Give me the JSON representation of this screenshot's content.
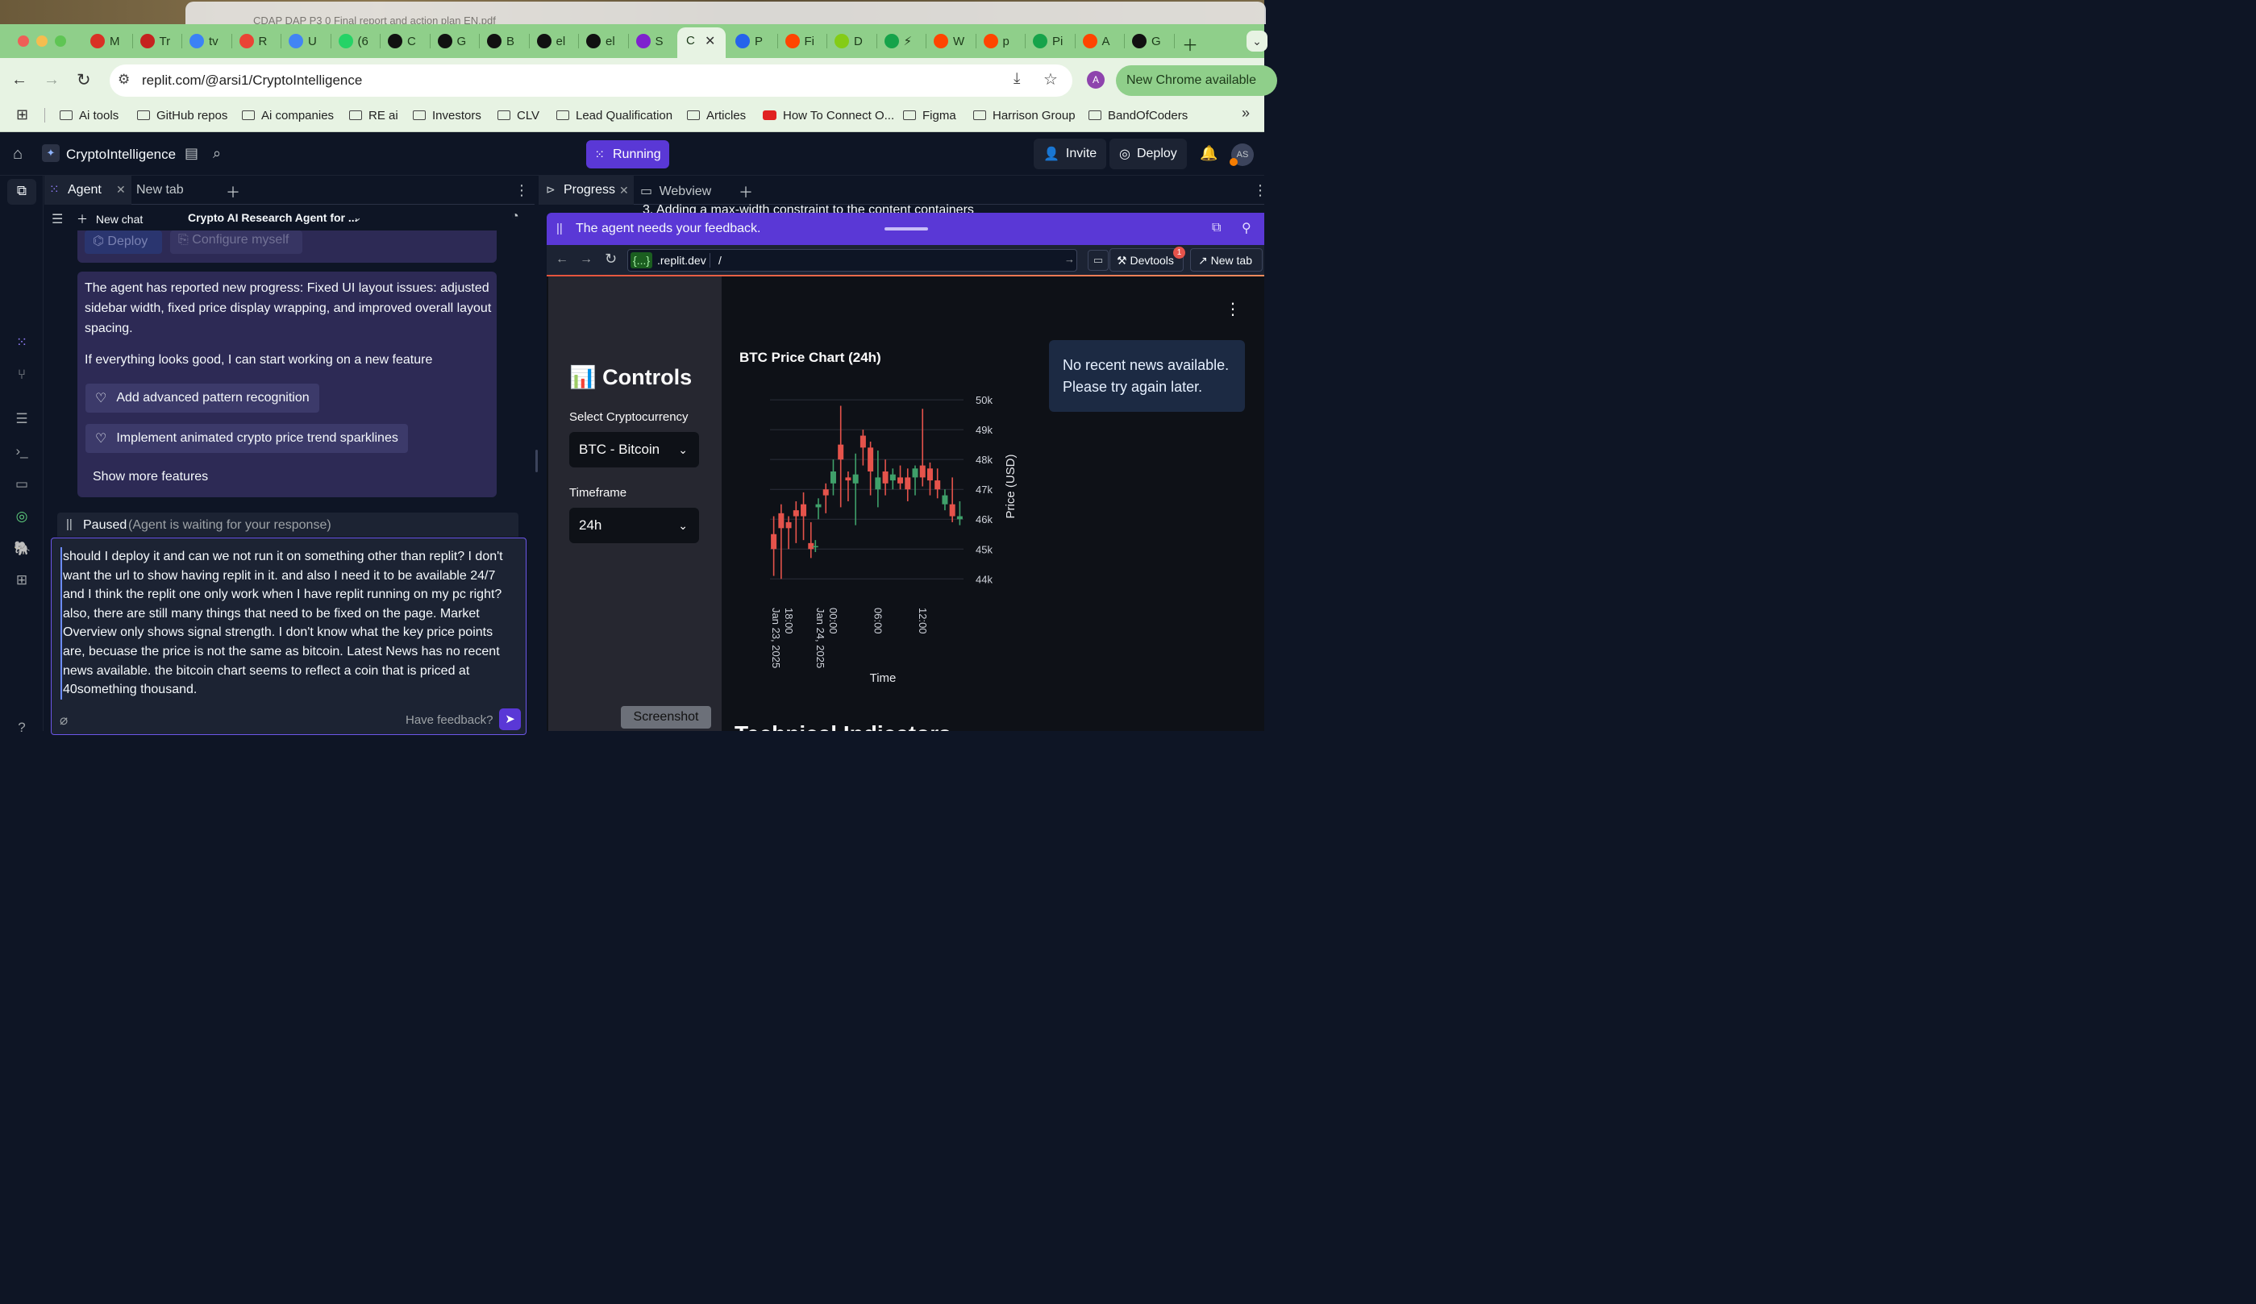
{
  "browser": {
    "bg_title": "CDAP DAP P3 0 Final report and action plan EN.pdf",
    "tabs": [
      {
        "label": "M",
        "color": "#d93025"
      },
      {
        "label": "Tr",
        "color": "#c5221f"
      },
      {
        "label": "tv",
        "color": "#3b82f6"
      },
      {
        "label": "R",
        "color": "#ea4335"
      },
      {
        "label": "U",
        "color": "#4285f4"
      },
      {
        "label": "(6",
        "color": "#25d366"
      },
      {
        "label": "C",
        "color": "#111111"
      },
      {
        "label": "G",
        "color": "#111111"
      },
      {
        "label": "B",
        "color": "#111111"
      },
      {
        "label": "el",
        "color": "#111111"
      },
      {
        "label": "el",
        "color": "#111111"
      },
      {
        "label": "S",
        "color": "#7e22ce"
      }
    ],
    "active_tab_label": "C",
    "right_tabs": [
      {
        "label": "P",
        "color": "#2563eb"
      },
      {
        "label": "Fi",
        "color": "#ff4500"
      },
      {
        "label": "D",
        "color": "#84cc16"
      },
      {
        "label": "⚡",
        "color": "#16a34a"
      },
      {
        "label": "W",
        "color": "#ff4500"
      },
      {
        "label": "p",
        "color": "#ff4500"
      },
      {
        "label": "Pi",
        "color": "#16a34a"
      },
      {
        "label": "A",
        "color": "#ff4500"
      },
      {
        "label": "G",
        "color": "#111111"
      }
    ],
    "url": "replit.com/@arsi1/CryptoIntelligence",
    "profile_initial": "A",
    "update_label": "New Chrome available",
    "bookmarks": [
      "Ai tools",
      "GitHub repos",
      "Ai companies",
      "RE ai",
      "Investors",
      "CLV",
      "Lead Qualification",
      "Articles",
      "How To Connect O...",
      "Figma",
      "Harrison Group",
      "BandOfCoders"
    ]
  },
  "replit": {
    "project_name": "CryptoIntelligence",
    "run_label": "Running",
    "invite_label": "Invite",
    "deploy_label": "Deploy",
    "avatar_initials": "AS",
    "left_tabs": {
      "agent": "Agent",
      "new_tab": "New tab"
    },
    "chat_bar": {
      "new_chat": "New chat",
      "title": "Crypto AI Research Agent for ..."
    },
    "top_card": {
      "deploy": "Deploy",
      "configure": "Configure myself"
    },
    "progress_message": "The agent has reported new progress: Fixed UI layout issues: adjusted sidebar width, fixed price display wrapping, and improved overall layout spacing.",
    "followup": "If everything looks good, I can start working on a new feature",
    "suggestions": [
      "Add advanced pattern recognition",
      "Implement animated crypto price trend sparklines"
    ],
    "show_more": "Show more features",
    "paused_label": "Paused",
    "paused_sub": "(Agent is waiting for your response)",
    "input_text": "should I deploy it and can we not run it on something other than replit? I don't want the url to show having replit in it. and also I need it to be available 24/7 and I think the replit one only work when I have replit running on my pc right? also, there are still many things that need to be fixed on the page. Market Overview only shows signal strength. I don't know what the key price points are, becuase the price is not the same as bitcoin. Latest News has no recent news available. the bitcoin chart seems to reflect a coin that is priced at 40something thousand.",
    "have_feedback": "Have feedback?",
    "right_tabs": {
      "progress": "Progress",
      "webview": "Webview"
    },
    "behind_text": "3. Adding a max-width constraint to the content containers",
    "feedback_bar": "The agent needs your feedback.",
    "webview": {
      "domain_prefix": "{...}",
      "domain": ".replit.dev",
      "path": "/",
      "devtools": "Devtools",
      "devtools_badge": "1",
      "new_tab": "New tab"
    },
    "screenshot_label": "Screenshot"
  },
  "app": {
    "controls_title": "Controls",
    "controls_emoji": "📊",
    "select_crypto_label": "Select Cryptocurrency",
    "select_crypto_value": "BTC - Bitcoin",
    "timeframe_label": "Timeframe",
    "timeframe_value": "24h",
    "news_message": "No recent news available. Please try again later.",
    "cutoff_heading": "Technical Indicators"
  },
  "chart_data": {
    "type": "candlestick",
    "title": "BTC Price Chart (24h)",
    "xlabel": "Time",
    "ylabel": "Price (USD)",
    "ylim": [
      43900,
      50300
    ],
    "yticks": [
      {
        "v": 44000,
        "label": "44k"
      },
      {
        "v": 45000,
        "label": "45k"
      },
      {
        "v": 46000,
        "label": "46k"
      },
      {
        "v": 47000,
        "label": "47k"
      },
      {
        "v": 48000,
        "label": "48k"
      },
      {
        "v": 49000,
        "label": "49k"
      },
      {
        "v": 50000,
        "label": "50k"
      }
    ],
    "xticks": [
      {
        "h": 18,
        "label": "18:00",
        "sub": "Jan 23, 2025"
      },
      {
        "h": 24,
        "label": "00:00",
        "sub": "Jan 24, 2025"
      },
      {
        "h": 30,
        "label": "06:00",
        "sub": ""
      },
      {
        "h": 36,
        "label": "12:00",
        "sub": ""
      }
    ],
    "xlim": [
      16.5,
      42.5
    ],
    "up_color": "#3fa06a",
    "down_color": "#e5534b",
    "candles": [
      {
        "h": 17.0,
        "o": 45500,
        "c": 45000,
        "hi": 46100,
        "lo": 44100
      },
      {
        "h": 18.0,
        "o": 46200,
        "c": 45700,
        "hi": 46500,
        "lo": 44000
      },
      {
        "h": 19.0,
        "o": 45900,
        "c": 45700,
        "hi": 46100,
        "lo": 45000
      },
      {
        "h": 20.0,
        "o": 46300,
        "c": 46100,
        "hi": 46600,
        "lo": 45200
      },
      {
        "h": 21.0,
        "o": 46500,
        "c": 46100,
        "hi": 46900,
        "lo": 45300
      },
      {
        "h": 22.0,
        "o": 45200,
        "c": 45000,
        "hi": 45900,
        "lo": 44700
      },
      {
        "h": 22.6,
        "o": 45100,
        "c": 45100,
        "hi": 45300,
        "lo": 44900
      },
      {
        "h": 23.0,
        "o": 46400,
        "c": 46500,
        "hi": 46700,
        "lo": 46000
      },
      {
        "h": 24.0,
        "o": 47000,
        "c": 46800,
        "hi": 47200,
        "lo": 46200
      },
      {
        "h": 25.0,
        "o": 47200,
        "c": 47600,
        "hi": 48000,
        "lo": 46800
      },
      {
        "h": 26.0,
        "o": 48500,
        "c": 48000,
        "hi": 49800,
        "lo": 46400
      },
      {
        "h": 27.0,
        "o": 47400,
        "c": 47300,
        "hi": 47600,
        "lo": 46600
      },
      {
        "h": 28.0,
        "o": 47200,
        "c": 47500,
        "hi": 48200,
        "lo": 45800
      },
      {
        "h": 29.0,
        "o": 48800,
        "c": 48400,
        "hi": 49000,
        "lo": 47800
      },
      {
        "h": 30.0,
        "o": 48400,
        "c": 47600,
        "hi": 48600,
        "lo": 46800
      },
      {
        "h": 31.0,
        "o": 47000,
        "c": 47400,
        "hi": 48300,
        "lo": 46400
      },
      {
        "h": 32.0,
        "o": 47600,
        "c": 47200,
        "hi": 48000,
        "lo": 46800
      },
      {
        "h": 33.0,
        "o": 47300,
        "c": 47500,
        "hi": 47700,
        "lo": 47000
      },
      {
        "h": 34.0,
        "o": 47400,
        "c": 47200,
        "hi": 47800,
        "lo": 47000
      },
      {
        "h": 35.0,
        "o": 47400,
        "c": 47000,
        "hi": 47700,
        "lo": 46600
      },
      {
        "h": 36.0,
        "o": 47400,
        "c": 47700,
        "hi": 47800,
        "lo": 46800
      },
      {
        "h": 37.0,
        "o": 47800,
        "c": 47400,
        "hi": 49700,
        "lo": 47100
      },
      {
        "h": 38.0,
        "o": 47700,
        "c": 47300,
        "hi": 47900,
        "lo": 46800
      },
      {
        "h": 39.0,
        "o": 47300,
        "c": 47000,
        "hi": 47700,
        "lo": 46700
      },
      {
        "h": 40.0,
        "o": 46500,
        "c": 46800,
        "hi": 47000,
        "lo": 46300
      },
      {
        "h": 41.0,
        "o": 46500,
        "c": 46100,
        "hi": 47400,
        "lo": 45900
      },
      {
        "h": 42.0,
        "o": 46000,
        "c": 46100,
        "hi": 46600,
        "lo": 45800
      }
    ]
  }
}
